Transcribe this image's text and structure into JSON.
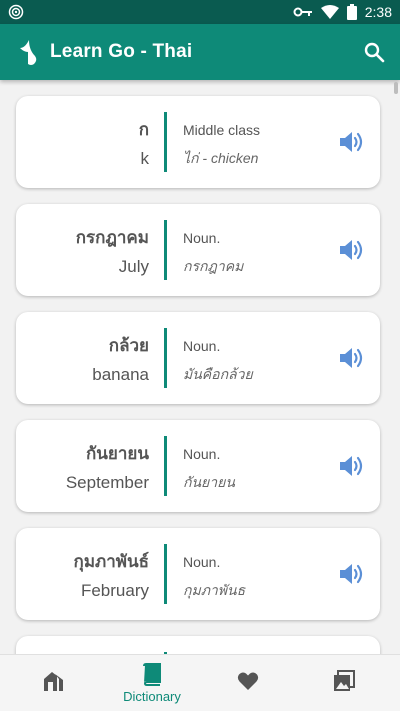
{
  "status_bar": {
    "time": "2:38",
    "icons": [
      "broadcast-icon",
      "key-icon",
      "wifi-icon",
      "battery-icon"
    ]
  },
  "app_bar": {
    "title": "Learn Go - Thai",
    "icons": [
      "app-logo-icon",
      "search-icon"
    ]
  },
  "cards": [
    {
      "thai": "ก",
      "english": "k",
      "pos": "Middle class",
      "example": "ไก่ - chicken"
    },
    {
      "thai": "กรกฎาคม",
      "english": "July",
      "pos": "Noun.",
      "example": "กรกฎาคม"
    },
    {
      "thai": "กล้วย",
      "english": "banana",
      "pos": "Noun.",
      "example": "มันคือกล้วย"
    },
    {
      "thai": "กันยายน",
      "english": "September",
      "pos": "Noun.",
      "example": "กันยายน"
    },
    {
      "thai": "กุมภาพันธ์",
      "english": "February",
      "pos": "Noun.",
      "example": "กุมภาพันธ"
    }
  ],
  "bottom_nav": {
    "items": [
      {
        "name": "home",
        "icon": "home-icon",
        "label": ""
      },
      {
        "name": "dictionary",
        "icon": "book-icon",
        "label": "Dictionary",
        "active": true
      },
      {
        "name": "favorites",
        "icon": "heart-icon",
        "label": ""
      },
      {
        "name": "images",
        "icon": "image-icon",
        "label": ""
      }
    ]
  },
  "colors": {
    "primary": "#0e8a78",
    "primary_dark": "#0a5b50",
    "speaker": "#5b8fd6",
    "text": "#555555"
  }
}
